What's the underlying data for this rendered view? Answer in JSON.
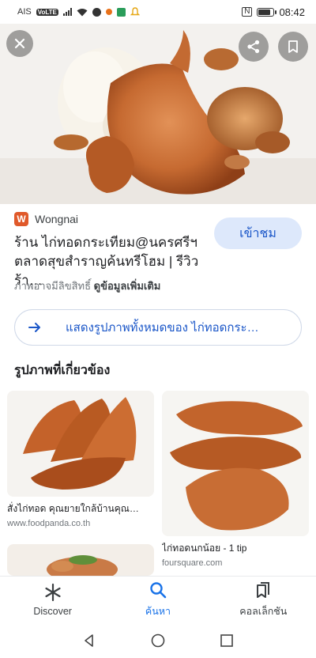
{
  "status_bar": {
    "carrier": "AIS",
    "volte": "VoLTE",
    "nfc": "N",
    "time": "08:42",
    "battery_level": 0.8
  },
  "hero": {
    "close_icon": "close-icon",
    "share_icon": "share-icon",
    "save_icon": "bookmark-icon"
  },
  "result": {
    "source_logo_letter": "W",
    "source_name": "Wongnai",
    "title": "ร้าน ไก่ทอดกระเทียม@นครศรีฯ ตลาดสุขสำราญค้นทรีโฮม | รีวิวร้า…",
    "visit_label": "เข้าชม",
    "copyright_text": "ภาพอาจมีลิขสิทธิ์",
    "more_info_link": "ดูข้อมูลเพิ่มเติม"
  },
  "show_all": {
    "label": "แสดงรูปภาพทั้งหมดของ ไก่ทอดกระ…",
    "icon": "arrow-right-icon"
  },
  "related": {
    "heading": "รูปภาพที่เกี่ยวข้อง",
    "items": [
      {
        "caption": "สั่งไก่ทอด คุณยายใกล้บ้านคุณ…",
        "source": "www.foodpanda.co.th"
      },
      {
        "caption": "ไก่ทอดนกน้อย - 1 tip",
        "source": "foursquare.com"
      },
      {
        "caption": "",
        "source": ""
      }
    ]
  },
  "bottom_nav": {
    "items": [
      {
        "label": "Discover",
        "icon": "asterisk-icon",
        "active": false
      },
      {
        "label": "ค้นหา",
        "icon": "search-icon",
        "active": true
      },
      {
        "label": "คอลเล็กชัน",
        "icon": "collections-icon",
        "active": false
      }
    ]
  },
  "system_nav": {
    "back_icon": "back-triangle-icon",
    "home_icon": "home-circle-icon",
    "recents_icon": "recents-square-icon"
  },
  "colors": {
    "accent": "#1a73e8",
    "link": "#1a56c8",
    "visit_bg": "#dde8fb",
    "wongnai": "#e0592a"
  }
}
